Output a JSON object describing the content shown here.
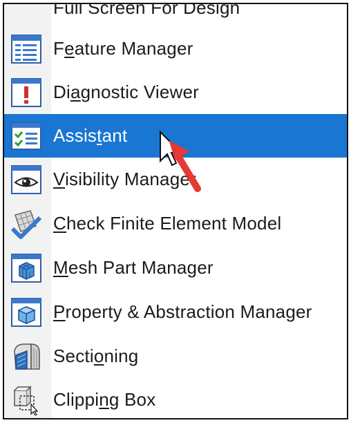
{
  "menu": {
    "items": [
      {
        "id": "full-screen",
        "pre": "Full Screen For Design",
        "u": "",
        "post": "",
        "icon": "full-screen-icon",
        "selected": false
      },
      {
        "id": "feature-manager",
        "pre": "F",
        "u": "e",
        "post": "ature Manager",
        "icon": "feature-manager-icon",
        "selected": false
      },
      {
        "id": "diagnostic-viewer",
        "pre": "Di",
        "u": "a",
        "post": "gnostic Viewer",
        "icon": "diagnostic-viewer-icon",
        "selected": false
      },
      {
        "id": "assistant",
        "pre": "Assis",
        "u": "t",
        "post": "ant",
        "icon": "assistant-checklist-icon",
        "selected": true
      },
      {
        "id": "visibility-manager",
        "pre": "",
        "u": "V",
        "post": "isibility Manager",
        "icon": "eye-icon",
        "selected": false
      },
      {
        "id": "check-finite-element-model",
        "pre": "",
        "u": "C",
        "post": "heck Finite Element Model",
        "icon": "check-mesh-icon",
        "selected": false
      },
      {
        "id": "mesh-part-manager",
        "pre": "",
        "u": "M",
        "post": "esh Part Manager",
        "icon": "mesh-part-icon",
        "selected": false
      },
      {
        "id": "property-abstraction-manager",
        "pre": "",
        "u": "P",
        "post": "roperty & Abstraction Manager",
        "icon": "cube-icon",
        "selected": false
      },
      {
        "id": "sectioning",
        "pre": "Secti",
        "u": "o",
        "post": "ning",
        "icon": "sectioning-icon",
        "selected": false
      },
      {
        "id": "clipping-box",
        "pre": "Clippi",
        "u": "n",
        "post": "g Box",
        "icon": "clipping-box-icon",
        "selected": false
      }
    ]
  },
  "colors": {
    "selection": "#1976d2",
    "cursor_arrow": "#e53935"
  }
}
